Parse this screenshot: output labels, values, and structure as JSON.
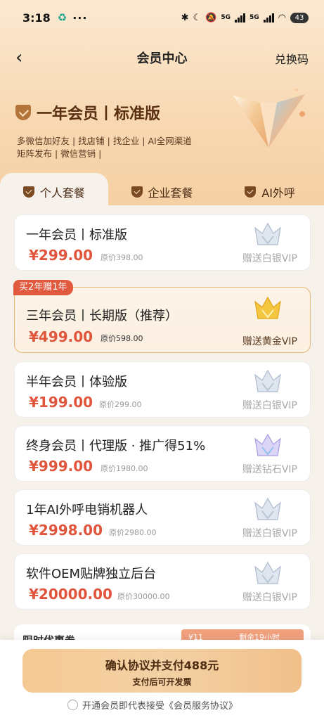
{
  "status_bar": {
    "time": "3:18",
    "dots": "···",
    "network_1": "5G",
    "network_2": "5G",
    "battery": "43"
  },
  "nav": {
    "back_icon": "‹",
    "title": "会员中心",
    "redeem": "兑换码"
  },
  "hero": {
    "title": "一年会员丨标准版",
    "desc_line1": "多微信加好友 | 找店铺 | 找企业 | AI全网渠道",
    "desc_line2": "矩阵发布 | 微信营销 |"
  },
  "tabs": [
    {
      "label": "个人套餐",
      "active": true
    },
    {
      "label": "企业套餐",
      "active": false
    },
    {
      "label": "AI外呼",
      "active": false
    }
  ],
  "plans": [
    {
      "name": "一年会员丨标准版",
      "price": "¥299.00",
      "original": "原价398.00",
      "gift": "赠送白银VIP",
      "crown": "silver-crown-icon"
    },
    {
      "name": "三年会员丨长期版（推荐）",
      "price": "¥499.00",
      "original": "原价598.00",
      "gift": "赠送黄金VIP",
      "crown": "gold-crown-icon",
      "badge": "买2年赠1年"
    },
    {
      "name": "半年会员丨体验版",
      "price": "¥199.00",
      "original": "原价299.00",
      "gift": "赠送白银VIP",
      "crown": "silver-crown-icon"
    },
    {
      "name": "终身会员丨代理版 · 推广得51%",
      "price": "¥999.00",
      "original": "原价1980.00",
      "gift": "赠送钻石VIP",
      "crown": "diamond-crown-icon"
    },
    {
      "name": "1年AI外呼电销机器人",
      "price": "¥2998.00",
      "original": "原价2980.00",
      "gift": "赠送白银VIP",
      "crown": "silver-crown-icon"
    },
    {
      "name": "软件OEM贴牌独立后台",
      "price": "¥20000.00",
      "original": "原价30000.00",
      "gift": "赠送白银VIP",
      "crown": "silver-crown-icon"
    }
  ],
  "coupon": {
    "label": "限时优惠券",
    "amount": "¥11",
    "remaining": "剩余19小时"
  },
  "checkout": {
    "button": "确认协议并支付488元",
    "sub": "支付后可开发票",
    "agree_prefix": "开通会员即代表接受",
    "agree_link": "《会员服务协议》"
  },
  "colors": {
    "price": "#e0553b",
    "badge": "#e25a3d",
    "brand_brown": "#5a2f12",
    "button_gold": "#f5c992"
  }
}
